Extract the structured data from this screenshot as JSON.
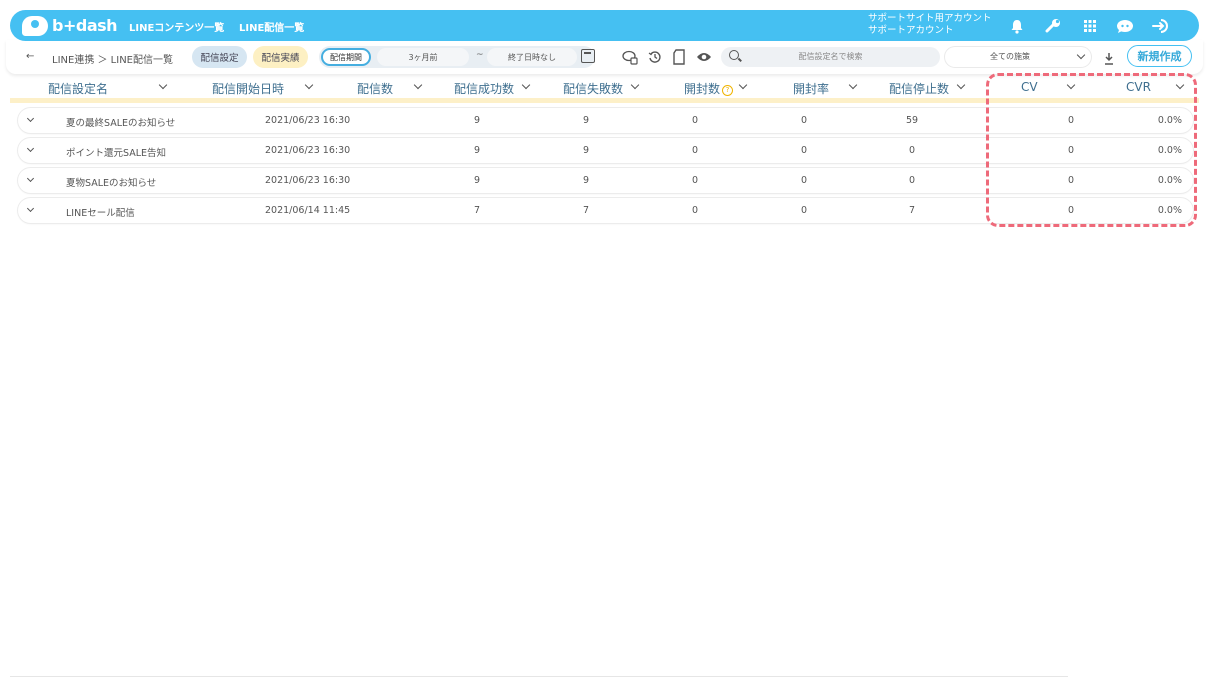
{
  "brand": {
    "name": "b+dash",
    "color": "#45c0f2"
  },
  "nav": {
    "link1": "LINEコンテンツ一覧",
    "link2": "LINE配信一覧"
  },
  "account": {
    "line1": "サポートサイト用アカウント",
    "line2": "サポートアカウント"
  },
  "header_icons": [
    "bell-icon",
    "wrench-icon",
    "grid-icon",
    "chat-icon",
    "logout-icon"
  ],
  "breadcrumb": {
    "back": "←",
    "text": "LINE連携 ＞ LINE配信一覧"
  },
  "tabs": {
    "settings": "配信設定",
    "results": "配信実績"
  },
  "period": {
    "label": "配信期間",
    "start": "3ヶ月前",
    "tilde": "~",
    "end": "終了日時なし"
  },
  "search": {
    "placeholder": "配信設定名で検索"
  },
  "filter": {
    "selected": "全ての施策"
  },
  "new_button": "新規作成",
  "columns": [
    "配信設定名",
    "配信開始日時",
    "配信数",
    "配信成功数",
    "配信失敗数",
    "開封数",
    "開封率",
    "配信停止数",
    "CV",
    "CVR"
  ],
  "help_mark": "?",
  "rows": [
    {
      "name": "夏の最終SALEのお知らせ",
      "date": "2021/06/23 16:30",
      "sent": "9",
      "success": "9",
      "fail": "0",
      "opens": "0",
      "stops": "59",
      "cv": "0",
      "cvr": "0.0%"
    },
    {
      "name": "ポイント還元SALE告知",
      "date": "2021/06/23 16:30",
      "sent": "9",
      "success": "9",
      "fail": "0",
      "opens": "0",
      "stops": "0",
      "cv": "0",
      "cvr": "0.0%"
    },
    {
      "name": "夏物SALEのお知らせ",
      "date": "2021/06/23 16:30",
      "sent": "9",
      "success": "9",
      "fail": "0",
      "opens": "0",
      "stops": "0",
      "cv": "0",
      "cvr": "0.0%"
    },
    {
      "name": "LINEセール配信",
      "date": "2021/06/14 11:45",
      "sent": "7",
      "success": "7",
      "fail": "0",
      "opens": "0",
      "stops": "7",
      "cv": "0",
      "cvr": "0.0%"
    }
  ],
  "highlight_color": "#ee6a7a"
}
